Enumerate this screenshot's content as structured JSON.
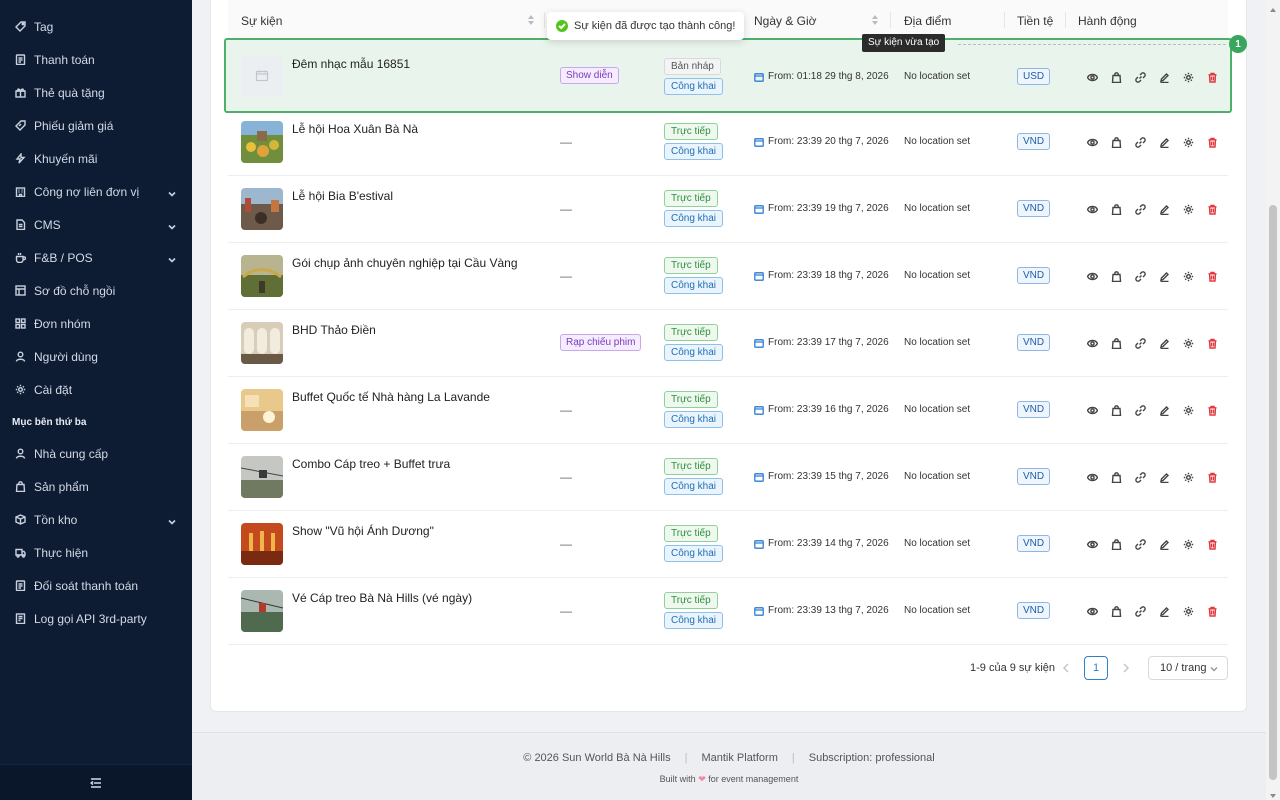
{
  "sidebar": {
    "items": [
      {
        "label": "Tag",
        "icon": "tag-icon"
      },
      {
        "label": "Thanh toán",
        "icon": "receipt-icon"
      },
      {
        "label": "Thẻ quà tặng",
        "icon": "gift-icon"
      },
      {
        "label": "Phiếu giảm giá",
        "icon": "coupon-icon"
      },
      {
        "label": "Khuyến mãi",
        "icon": "lightning-icon"
      },
      {
        "label": "Công nợ liên đơn vị",
        "icon": "building-icon",
        "expandable": true
      },
      {
        "label": "CMS",
        "icon": "document-icon",
        "expandable": true
      },
      {
        "label": "F&B / POS",
        "icon": "coffee-icon",
        "expandable": true
      },
      {
        "label": "Sơ đồ chỗ ngồi",
        "icon": "layout-icon"
      },
      {
        "label": "Đơn nhóm",
        "icon": "grid-icon"
      },
      {
        "label": "Người dùng",
        "icon": "user-icon"
      },
      {
        "label": "Cài đặt",
        "icon": "gear-icon"
      }
    ],
    "section_title": "Mục bên thứ ba",
    "third_party_items": [
      {
        "label": "Nhà cung cấp",
        "icon": "user-icon"
      },
      {
        "label": "Sản phẩm",
        "icon": "bag-icon"
      },
      {
        "label": "Tồn kho",
        "icon": "box-icon",
        "expandable": true
      },
      {
        "label": "Thực hiện",
        "icon": "truck-icon"
      },
      {
        "label": "Đối soát thanh toán",
        "icon": "receipt-icon"
      },
      {
        "label": "Log gọi API 3rd-party",
        "icon": "log-icon"
      }
    ],
    "collapse_icon": "menu-fold-icon"
  },
  "table": {
    "columns": {
      "event": "Sự kiện",
      "datetime": "Ngày & Giờ",
      "location": "Địa điểm",
      "currency": "Tiền tệ",
      "actions": "Hành động"
    },
    "rows": [
      {
        "name": "Đêm nhạc mẫu 16851",
        "type": "Show diễn",
        "status": "Bản nháp",
        "visibility": "Công khai",
        "date": "From: 01:18 29 thg 8, 2026",
        "location": "No location set",
        "currency": "USD"
      },
      {
        "name": "Lễ hội Hoa Xuân Bà Nà",
        "type": "—",
        "status": "Trực tiếp",
        "visibility": "Công khai",
        "date": "From: 23:39 20 thg 7, 2026",
        "location": "No location set",
        "currency": "VND"
      },
      {
        "name": "Lễ hội Bia B'estival",
        "type": "—",
        "status": "Trực tiếp",
        "visibility": "Công khai",
        "date": "From: 23:39 19 thg 7, 2026",
        "location": "No location set",
        "currency": "VND"
      },
      {
        "name": "Gói chụp ảnh chuyên nghiệp tại Cầu Vàng",
        "type": "—",
        "status": "Trực tiếp",
        "visibility": "Công khai",
        "date": "From: 23:39 18 thg 7, 2026",
        "location": "No location set",
        "currency": "VND"
      },
      {
        "name": "BHD Thảo Điền",
        "type": "Rạp chiếu phim",
        "status": "Trực tiếp",
        "visibility": "Công khai",
        "date": "From: 23:39 17 thg 7, 2026",
        "location": "No location set",
        "currency": "VND"
      },
      {
        "name": "Buffet Quốc tế Nhà hàng La Lavande",
        "type": "—",
        "status": "Trực tiếp",
        "visibility": "Công khai",
        "date": "From: 23:39 16 thg 7, 2026",
        "location": "No location set",
        "currency": "VND"
      },
      {
        "name": "Combo Cáp treo + Buffet trưa",
        "type": "—",
        "status": "Trực tiếp",
        "visibility": "Công khai",
        "date": "From: 23:39 15 thg 7, 2026",
        "location": "No location set",
        "currency": "VND"
      },
      {
        "name": "Show \"Vũ hội Ánh Dương\"",
        "type": "—",
        "status": "Trực tiếp",
        "visibility": "Công khai",
        "date": "From: 23:39 14 thg 7, 2026",
        "location": "No location set",
        "currency": "VND"
      },
      {
        "name": "Vé Cáp treo Bà Nà Hills (vé ngày)",
        "type": "—",
        "status": "Trực tiếp",
        "visibility": "Công khai",
        "date": "From: 23:39 13 thg 7, 2026",
        "location": "No location set",
        "currency": "VND"
      }
    ],
    "row_actions": [
      "eye-icon",
      "bag-icon",
      "link-icon",
      "edit-icon",
      "gear-icon",
      "trash-icon"
    ]
  },
  "toast": {
    "message": "Sự kiện đã được tạo thành công!"
  },
  "tooltip": {
    "text": "Sự kiện vừa tạo",
    "badge": "1"
  },
  "pagination": {
    "info": "1-9 của 9 sự kiện",
    "current_page": "1",
    "page_size": "10 / trang"
  },
  "footer": {
    "copyright": "© 2026 Sun World Bà Nà Hills",
    "platform": "Mantik Platform",
    "subscription": "Subscription: professional",
    "built_prefix": "Built with",
    "built_suffix": "for event management"
  },
  "colors": {
    "sidebar_bg": "#0d1b33",
    "accent": "#2f7fd0",
    "success": "#4caf6a",
    "danger": "#e0383e"
  }
}
